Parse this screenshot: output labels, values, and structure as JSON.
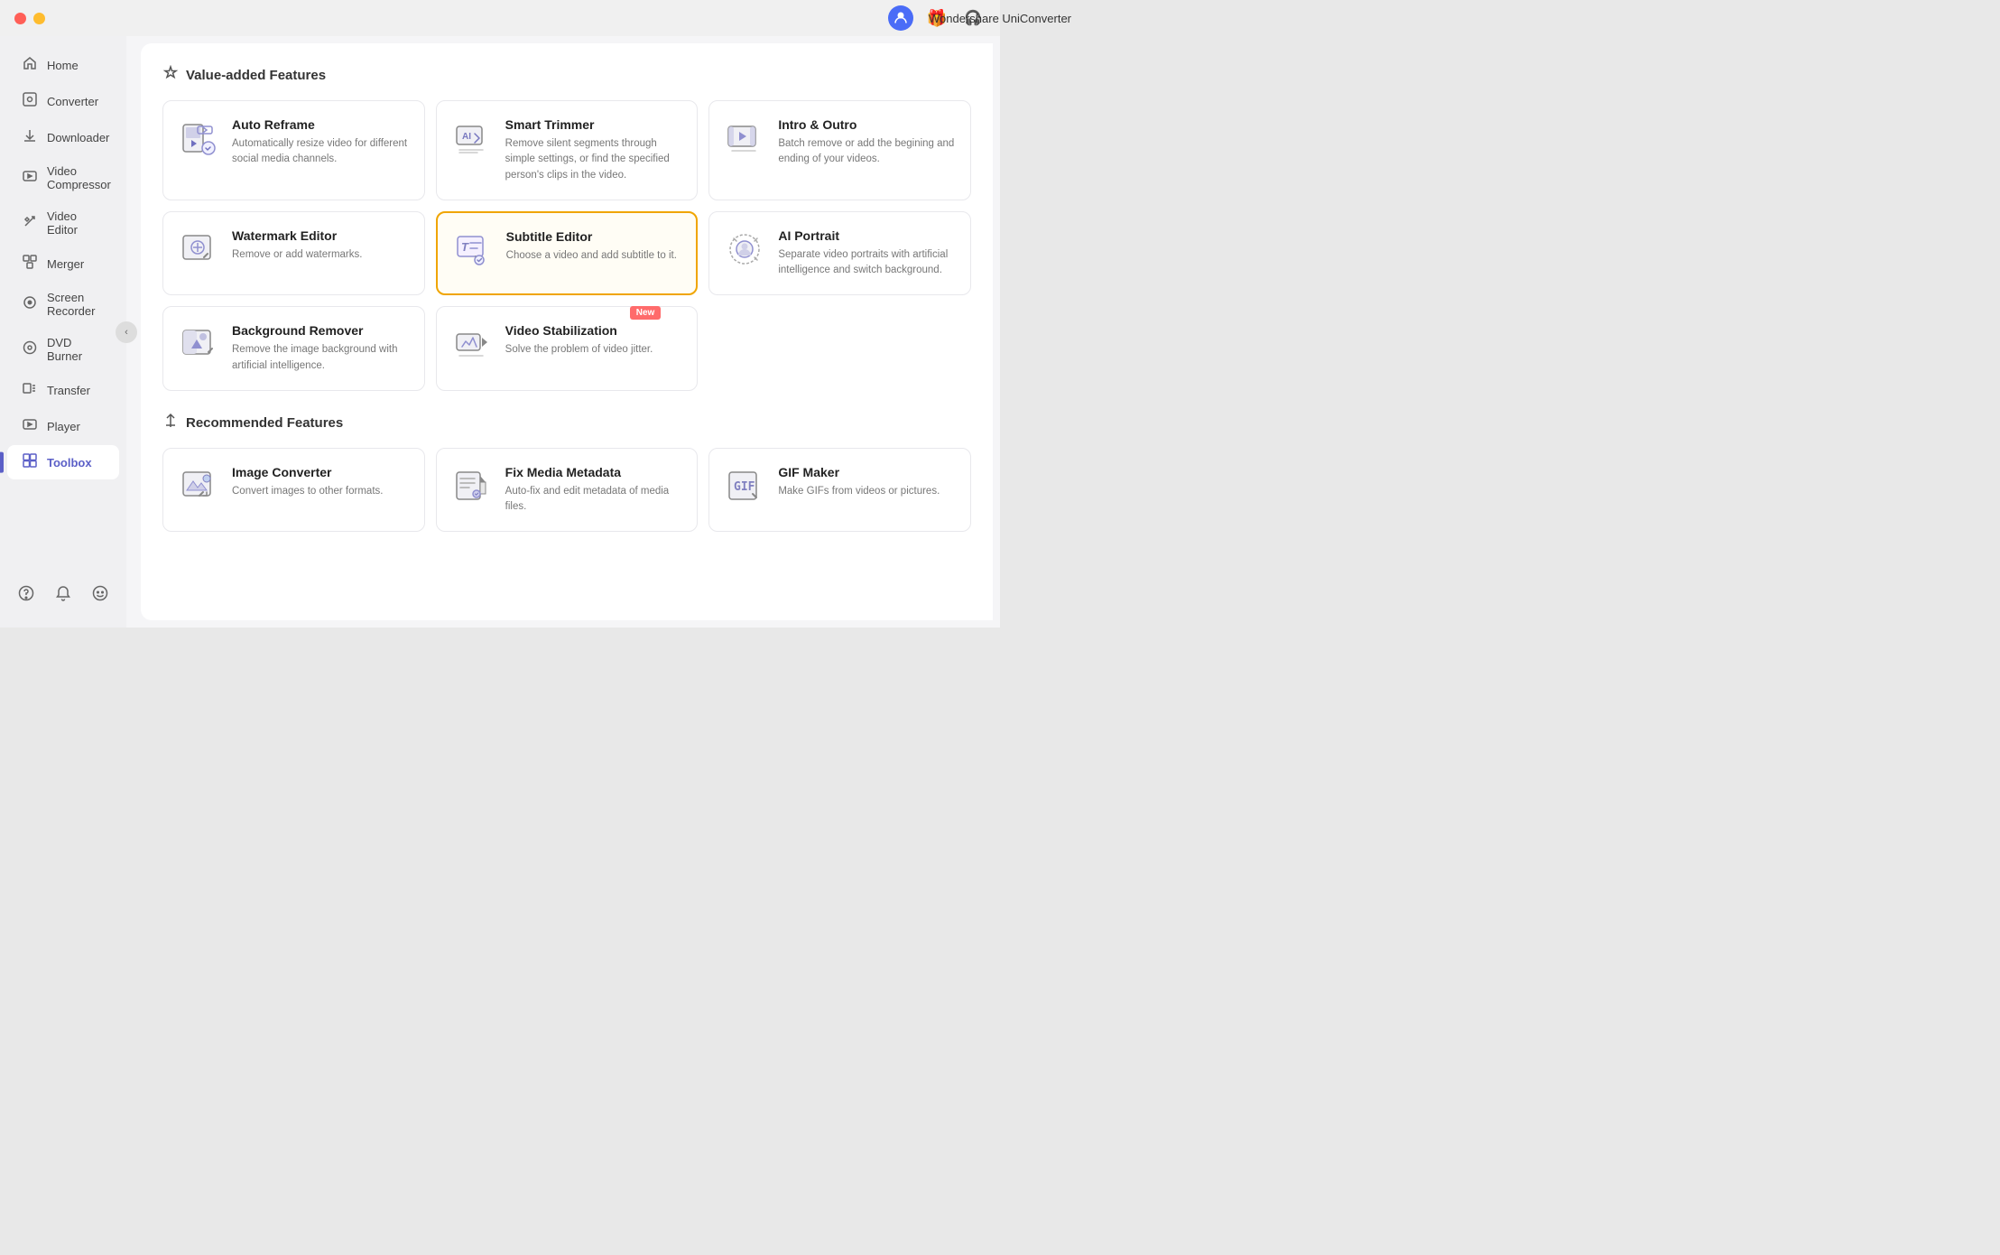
{
  "titlebar": {
    "title": "Wondershare UniConverter",
    "icons": {
      "user": "👤",
      "gift": "🎁",
      "support": "🎧"
    }
  },
  "sidebar": {
    "items": [
      {
        "id": "home",
        "label": "Home",
        "icon": "⌂"
      },
      {
        "id": "converter",
        "label": "Converter",
        "icon": "⊡"
      },
      {
        "id": "downloader",
        "label": "Downloader",
        "icon": "⬇"
      },
      {
        "id": "video-compressor",
        "label": "Video Compressor",
        "icon": "▣"
      },
      {
        "id": "video-editor",
        "label": "Video Editor",
        "icon": "✂"
      },
      {
        "id": "merger",
        "label": "Merger",
        "icon": "⊞"
      },
      {
        "id": "screen-recorder",
        "label": "Screen Recorder",
        "icon": "⊙"
      },
      {
        "id": "dvd-burner",
        "label": "DVD Burner",
        "icon": "◎"
      },
      {
        "id": "transfer",
        "label": "Transfer",
        "icon": "⊟"
      },
      {
        "id": "player",
        "label": "Player",
        "icon": "▶"
      },
      {
        "id": "toolbox",
        "label": "Toolbox",
        "icon": "⊞",
        "active": true
      }
    ],
    "bottom_buttons": [
      "?",
      "🔔",
      "😊"
    ]
  },
  "main": {
    "value_added_section": {
      "header": "Value-added Features",
      "features": [
        {
          "id": "auto-reframe",
          "title": "Auto Reframe",
          "desc": "Automatically resize video for different social media channels.",
          "icon_type": "auto-reframe",
          "selected": false,
          "new": false
        },
        {
          "id": "smart-trimmer",
          "title": "Smart Trimmer",
          "desc": "Remove silent segments through simple settings, or find the specified person's clips in the video.",
          "icon_type": "smart-trimmer",
          "selected": false,
          "new": false
        },
        {
          "id": "intro-outro",
          "title": "Intro & Outro",
          "desc": "Batch remove or add the begining and ending of your videos.",
          "icon_type": "intro-outro",
          "selected": false,
          "new": false
        },
        {
          "id": "watermark-editor",
          "title": "Watermark Editor",
          "desc": "Remove or add watermarks.",
          "icon_type": "watermark-editor",
          "selected": false,
          "new": false
        },
        {
          "id": "subtitle-editor",
          "title": "Subtitle Editor",
          "desc": "Choose a video and add subtitle to it.",
          "icon_type": "subtitle-editor",
          "selected": true,
          "new": false
        },
        {
          "id": "ai-portrait",
          "title": "AI Portrait",
          "desc": "Separate video portraits with artificial intelligence and switch background.",
          "icon_type": "ai-portrait",
          "selected": false,
          "new": false
        },
        {
          "id": "background-remover",
          "title": "Background Remover",
          "desc": "Remove the image background with artificial intelligence.",
          "icon_type": "background-remover",
          "selected": false,
          "new": false
        },
        {
          "id": "video-stabilization",
          "title": "Video Stabilization",
          "desc": "Solve the problem of video jitter.",
          "icon_type": "video-stabilization",
          "selected": false,
          "new": true
        }
      ]
    },
    "recommended_section": {
      "header": "Recommended Features",
      "features": [
        {
          "id": "image-converter",
          "title": "Image Converter",
          "desc": "Convert images to other formats.",
          "icon_type": "image-converter",
          "selected": false,
          "new": false
        },
        {
          "id": "fix-media-metadata",
          "title": "Fix Media Metadata",
          "desc": "Auto-fix and edit metadata of media files.",
          "icon_type": "fix-media",
          "selected": false,
          "new": false
        },
        {
          "id": "gif-maker",
          "title": "GIF Maker",
          "desc": "Make GIFs from videos or pictures.",
          "icon_type": "gif-maker",
          "selected": false,
          "new": false
        }
      ]
    },
    "new_label": "New"
  }
}
